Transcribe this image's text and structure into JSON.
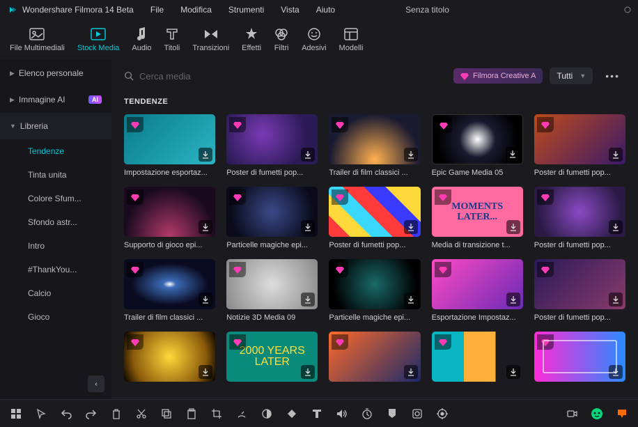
{
  "app_title": "Wondershare Filmora 14 Beta",
  "menu": [
    "File",
    "Modifica",
    "Strumenti",
    "Vista",
    "Aiuto"
  ],
  "doc_title": "Senza titolo",
  "main_tabs": [
    {
      "label": "File Multimediali"
    },
    {
      "label": "Stock Media"
    },
    {
      "label": "Audio"
    },
    {
      "label": "Titoli"
    },
    {
      "label": "Transizioni"
    },
    {
      "label": "Effetti"
    },
    {
      "label": "Filtri"
    },
    {
      "label": "Adesivi"
    },
    {
      "label": "Modelli"
    }
  ],
  "sidebar": {
    "sections": [
      {
        "label": "Elenco personale"
      },
      {
        "label": "Immagine AI",
        "badge": "AI"
      },
      {
        "label": "Libreria",
        "expanded": true
      }
    ],
    "subitems": [
      "Tendenze",
      "Tinta unita",
      "Colore Sfum...",
      "Sfondo astr...",
      "Intro",
      "#ThankYou...",
      "Calcio",
      "Gioco"
    ]
  },
  "search": {
    "placeholder": "Cerca media"
  },
  "header": {
    "creative_btn": "Filmora Creative A",
    "filter": "Tutti"
  },
  "section_title": "TENDENZE",
  "cards": [
    {
      "title": "Impostazione esportaz...",
      "bg": "bg0"
    },
    {
      "title": "Poster di fumetti pop...",
      "bg": "bg1"
    },
    {
      "title": "Trailer di film classici ...",
      "bg": "bg2"
    },
    {
      "title": "Epic Game Media 05",
      "bg": "bg3"
    },
    {
      "title": "Poster di fumetti pop...",
      "bg": "bg4"
    },
    {
      "title": "Supporto di gioco epi...",
      "bg": "bg5"
    },
    {
      "title": "Particelle magiche epi...",
      "bg": "bg6"
    },
    {
      "title": "Poster di fumetti pop...",
      "bg": "bg7"
    },
    {
      "title": "Media di transizione t...",
      "bg": "bg8",
      "overlay": "MOMENTS LATER..."
    },
    {
      "title": "Poster di fumetti pop...",
      "bg": "bg9"
    },
    {
      "title": "Trailer di film classici ...",
      "bg": "bg10"
    },
    {
      "title": "Notizie 3D Media 09",
      "bg": "bg11"
    },
    {
      "title": "Particelle magiche epi...",
      "bg": "bg12"
    },
    {
      "title": "Esportazione Impostaz...",
      "bg": "bg13"
    },
    {
      "title": "Poster di fumetti pop...",
      "bg": "bg14"
    },
    {
      "title": "",
      "bg": "bg15"
    },
    {
      "title": "",
      "bg": "bg16",
      "overlay": "2000 YEARS LATER"
    },
    {
      "title": "",
      "bg": "bg17"
    },
    {
      "title": "",
      "bg": "bg18"
    },
    {
      "title": "",
      "bg": "bg19"
    }
  ]
}
